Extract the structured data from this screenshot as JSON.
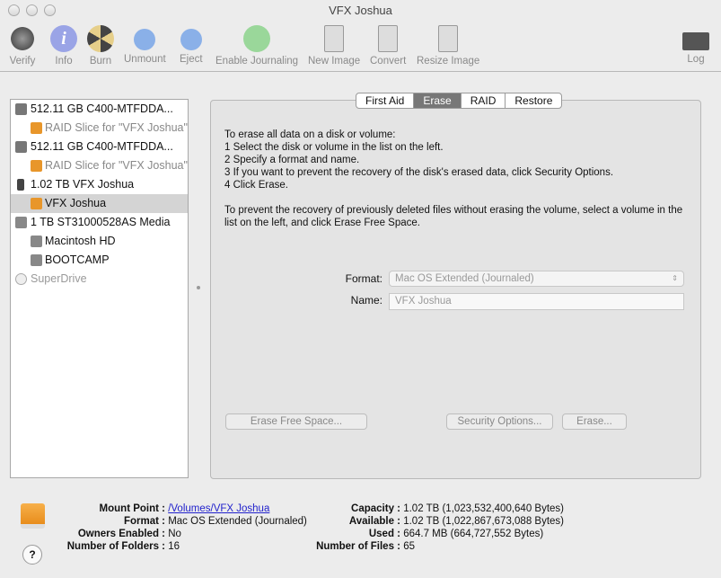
{
  "window": {
    "title": "VFX Joshua"
  },
  "toolbar": [
    {
      "label": "Verify",
      "icon": "microscope-icon"
    },
    {
      "label": "Info",
      "icon": "info-icon"
    },
    {
      "label": "Burn",
      "icon": "burn-icon"
    },
    {
      "label": "Unmount",
      "icon": "unmount-icon"
    },
    {
      "label": "Eject",
      "icon": "eject-icon"
    },
    {
      "label": "Enable Journaling",
      "icon": "journaling-icon"
    },
    {
      "label": "New Image",
      "icon": "new-image-icon"
    },
    {
      "label": "Convert",
      "icon": "convert-icon"
    },
    {
      "label": "Resize Image",
      "icon": "resize-image-icon"
    },
    {
      "label": "Log",
      "icon": "log-icon"
    }
  ],
  "sidebar": [
    {
      "label": "512.11 GB C400-MTFDDA..."
    },
    {
      "label": "RAID Slice for \"VFX Joshua\""
    },
    {
      "label": "512.11 GB C400-MTFDDA..."
    },
    {
      "label": "RAID Slice for \"VFX Joshua\""
    },
    {
      "label": "1.02 TB VFX Joshua"
    },
    {
      "label": "VFX Joshua"
    },
    {
      "label": "1 TB ST31000528AS Media"
    },
    {
      "label": "Macintosh HD"
    },
    {
      "label": "BOOTCAMP"
    },
    {
      "label": "SuperDrive"
    }
  ],
  "tabs": [
    "First Aid",
    "Erase",
    "RAID",
    "Restore"
  ],
  "erase": {
    "instructions": [
      "To erase all data on a disk or volume:",
      "1 Select the disk or volume in the list on the left.",
      "2 Specify a format and name.",
      "3 If you want to prevent the recovery of the disk's erased data, click Security Options.",
      "4 Click Erase."
    ],
    "free_space_note": "To prevent the recovery of previously deleted files without erasing the volume, select a volume in the list on the left, and click Erase Free Space.",
    "format_label": "Format:",
    "format_value": "Mac OS Extended (Journaled)",
    "name_label": "Name:",
    "name_value": "VFX Joshua",
    "erase_free_space": "Erase Free Space...",
    "security_options": "Security Options...",
    "erase": "Erase..."
  },
  "info": {
    "mount_point_k": "Mount Point :",
    "mount_point": "/Volumes/VFX Joshua",
    "format_k": "Format :",
    "format": "Mac OS Extended (Journaled)",
    "owners_k": "Owners Enabled :",
    "owners": "No",
    "folders_k": "Number of Folders :",
    "folders": "16",
    "capacity_k": "Capacity :",
    "capacity": "1.02 TB (1,023,532,400,640 Bytes)",
    "available_k": "Available :",
    "available": "1.02 TB (1,022,867,673,088 Bytes)",
    "used_k": "Used :",
    "used": "664.7 MB (664,727,552 Bytes)",
    "files_k": "Number of Files :",
    "files": "65",
    "help": "?"
  }
}
